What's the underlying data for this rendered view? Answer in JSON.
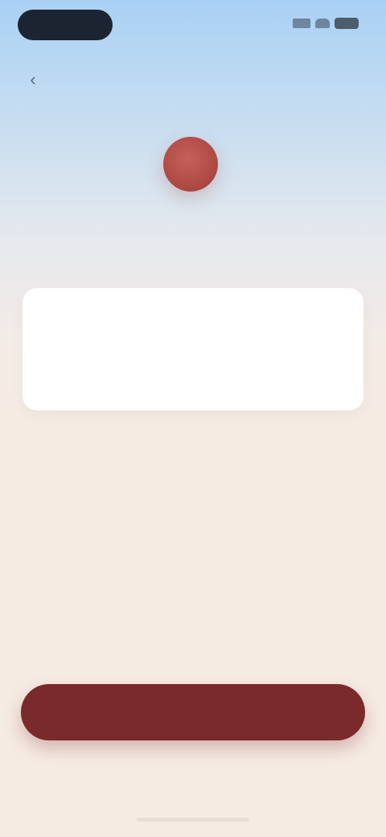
{
  "status_bar": {
    "icons": [
      "signal-icon",
      "wifi-icon",
      "battery-icon"
    ]
  },
  "nav": {
    "back_icon": "chevron-left-icon",
    "title": ""
  },
  "header": {
    "title": "",
    "subtitle": ""
  },
  "form": {
    "label": "",
    "value": "",
    "placeholder": "",
    "char_count": ""
  },
  "actions": {
    "primary_label": "",
    "secondary_label": ""
  },
  "colors": {
    "accent": "#7a2a2a",
    "avatar": "#b04a45",
    "background_top": "#a9d1f5",
    "background_bottom": "#f6ebe3"
  }
}
